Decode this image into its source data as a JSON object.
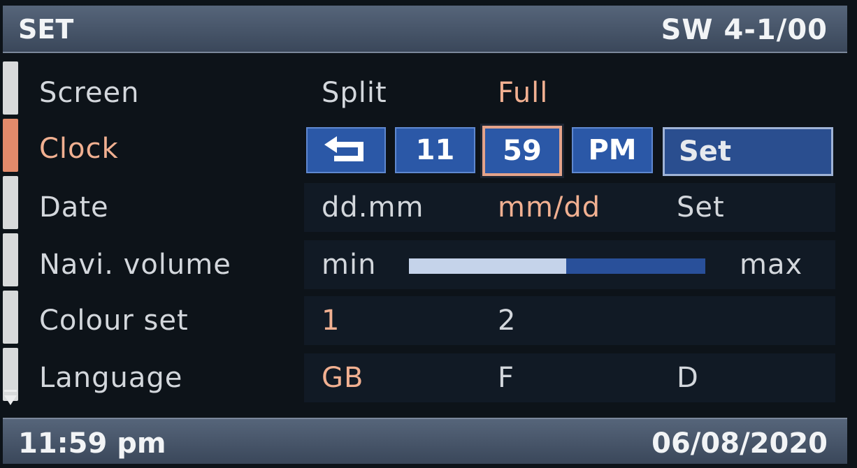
{
  "header": {
    "title": "SET",
    "version": "SW 4-1/00"
  },
  "menu": {
    "screen": {
      "label": "Screen",
      "options": [
        "Split",
        "Full"
      ],
      "selected": "Full"
    },
    "clock": {
      "label": "Clock",
      "back_icon": "return-arrow-icon",
      "hour": "11",
      "minute": "59",
      "ampm": "PM",
      "set_label": "Set"
    },
    "date": {
      "label": "Date",
      "options": [
        "dd.mm",
        "mm/dd",
        "Set"
      ],
      "selected": "mm/dd"
    },
    "navi_volume": {
      "label": "Navi. volume",
      "min_label": "min",
      "max_label": "max",
      "level": 0.53
    },
    "colour_set": {
      "label": "Colour set",
      "options": [
        "1",
        "2"
      ],
      "selected": "1"
    },
    "language": {
      "label": "Language",
      "options": [
        "GB",
        "F",
        "D"
      ],
      "selected": "GB"
    }
  },
  "status": {
    "time": "11:59 pm",
    "date": "06/08/2020"
  },
  "colors": {
    "accent": "#f1b091",
    "selection_blue": "#2b58a7",
    "bar": "#4a586c"
  }
}
